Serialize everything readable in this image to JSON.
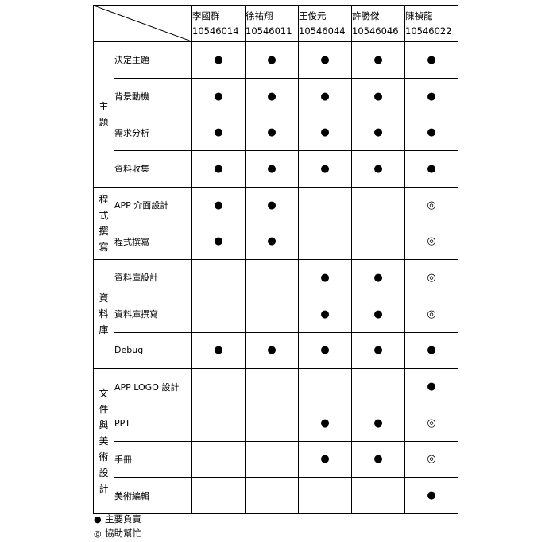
{
  "members": [
    {
      "name": "李國群",
      "id": "10546014"
    },
    {
      "name": "徐祐翔",
      "id": "10546011"
    },
    {
      "name": "王俊元",
      "id": "10546044"
    },
    {
      "name": "許勝傑",
      "id": "10546046"
    },
    {
      "name": "陳禎龍",
      "id": "10546022"
    }
  ],
  "symbols": {
    "main": "●",
    "assist": "◎"
  },
  "groups": [
    {
      "category": [
        "主",
        "題"
      ],
      "tasks": [
        {
          "label": "決定主題",
          "marks": [
            "main",
            "main",
            "main",
            "main",
            "main"
          ]
        },
        {
          "label": "背景動機",
          "marks": [
            "main",
            "main",
            "main",
            "main",
            "main"
          ]
        },
        {
          "label": "需求分析",
          "marks": [
            "main",
            "main",
            "main",
            "main",
            "main"
          ]
        },
        {
          "label": "資料收集",
          "marks": [
            "main",
            "main",
            "main",
            "main",
            "main"
          ]
        }
      ]
    },
    {
      "category": [
        "程",
        "式",
        "撰",
        "寫"
      ],
      "tasks": [
        {
          "label": "APP 介面設計",
          "marks": [
            "main",
            "main",
            "",
            "",
            "assist"
          ]
        },
        {
          "label": "程式撰寫",
          "marks": [
            "main",
            "main",
            "",
            "",
            "assist"
          ]
        }
      ]
    },
    {
      "category": [
        "資",
        "料",
        "庫"
      ],
      "tasks": [
        {
          "label": "資料庫設計",
          "marks": [
            "",
            "",
            "main",
            "main",
            "assist"
          ]
        },
        {
          "label": "資料庫撰寫",
          "marks": [
            "",
            "",
            "main",
            "main",
            "assist"
          ]
        },
        {
          "label": "Debug",
          "marks": [
            "main",
            "main",
            "main",
            "main",
            "main"
          ]
        }
      ]
    },
    {
      "category": [
        "文",
        "件",
        "與",
        "美",
        "術",
        "設",
        "計"
      ],
      "tasks": [
        {
          "label": "APP LOGO 設計",
          "marks": [
            "",
            "",
            "",
            "",
            "main"
          ]
        },
        {
          "label": "PPT",
          "marks": [
            "",
            "",
            "main",
            "main",
            "assist"
          ]
        },
        {
          "label": "手冊",
          "marks": [
            "",
            "",
            "main",
            "main",
            "assist"
          ]
        },
        {
          "label": "美術編輯",
          "marks": [
            "",
            "",
            "",
            "",
            "main"
          ]
        }
      ]
    }
  ],
  "legend": [
    {
      "symbol": "●",
      "label": "主要負責"
    },
    {
      "symbol": "◎",
      "label": "協助幫忙"
    }
  ]
}
